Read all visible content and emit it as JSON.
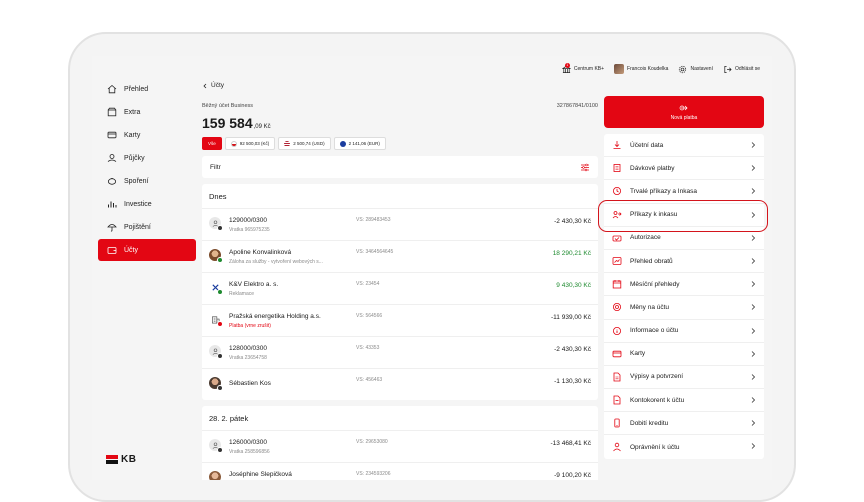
{
  "topbar": {
    "centrum": "Centrum KB+",
    "notif_count": "1",
    "user": "Francois Koudelka",
    "settings": "Nastavení",
    "logout": "Odhlásit se"
  },
  "sidebar": {
    "items": [
      {
        "label": "Přehled",
        "icon": "home-icon"
      },
      {
        "label": "Extra",
        "icon": "box-icon"
      },
      {
        "label": "Karty",
        "icon": "card-icon"
      },
      {
        "label": "Půjčky",
        "icon": "loan-icon"
      },
      {
        "label": "Spoření",
        "icon": "piggy-icon"
      },
      {
        "label": "Investice",
        "icon": "chart-icon"
      },
      {
        "label": "Pojištění",
        "icon": "umbrella-icon"
      },
      {
        "label": "Účty",
        "icon": "wallet-icon"
      }
    ],
    "logo": "KB"
  },
  "main": {
    "back": "Účty",
    "account_name": "Běžný účet Business",
    "account_number": "327867841/0100",
    "balance_int": "159 584",
    "balance_dec": ",09 Kč",
    "chips": [
      {
        "label": "Vše"
      },
      {
        "label": "92 500,03 (Kč)"
      },
      {
        "label": "2 500,74 (USD)"
      },
      {
        "label": "2 141,06 (EUR)"
      }
    ],
    "filter": "Filtr",
    "groups": [
      {
        "title": "Dnes",
        "rows": [
          {
            "name": "129000/0300",
            "sub": "Vratka 965975235",
            "vs": "VS: 289483453",
            "amount": "-2 430,30 Kč"
          },
          {
            "name": "Apoline Konvalinková",
            "sub": "Záloha za služby - vytvoření webových s...",
            "vs": "VS: 3464564645",
            "amount": "18 290,21 Kč"
          },
          {
            "name": "K&V Elektro a. s.",
            "sub": "Reklamace",
            "vs": "VS: 23454",
            "amount": "9 430,30 Kč"
          },
          {
            "name": "Pražská energetika Holding a.s.",
            "sub": "Platba (vrne zrušit)",
            "vs": "VS: 564566",
            "amount": "-11 939,00 Kč"
          },
          {
            "name": "128000/0300",
            "sub": "Vratka 23654758",
            "vs": "VS: 43353",
            "amount": "-2 430,30 Kč"
          },
          {
            "name": "Sébastien Kos",
            "sub": "",
            "vs": "VS: 456463",
            "amount": "-1 130,30 Kč"
          }
        ]
      },
      {
        "title": "28. 2. pátek",
        "rows": [
          {
            "name": "126000/0300",
            "sub": "Vratka 258596856",
            "vs": "VS: 29653080",
            "amount": "-13 468,41 Kč"
          },
          {
            "name": "Joséphine Slepičková",
            "sub": "",
            "vs": "VS: 234593206",
            "amount": "-9 100,20 Kč"
          }
        ]
      }
    ]
  },
  "right": {
    "pay_button": "Nová platba",
    "menu": [
      "Účetní data",
      "Dávkové platby",
      "Trvalé příkazy a Inkasa",
      "Příkazy k inkasu",
      "Autorizace",
      "Přehled obratů",
      "Měsíční přehledy",
      "Měny na účtu",
      "Informace o účtu",
      "Karty",
      "Výpisy a potvrzení",
      "Kontokorent k účtu",
      "Dobití kreditu",
      "Oprávnění k účtu"
    ]
  },
  "colors": {
    "accent": "#e30613",
    "positive": "#1e8a2f"
  }
}
